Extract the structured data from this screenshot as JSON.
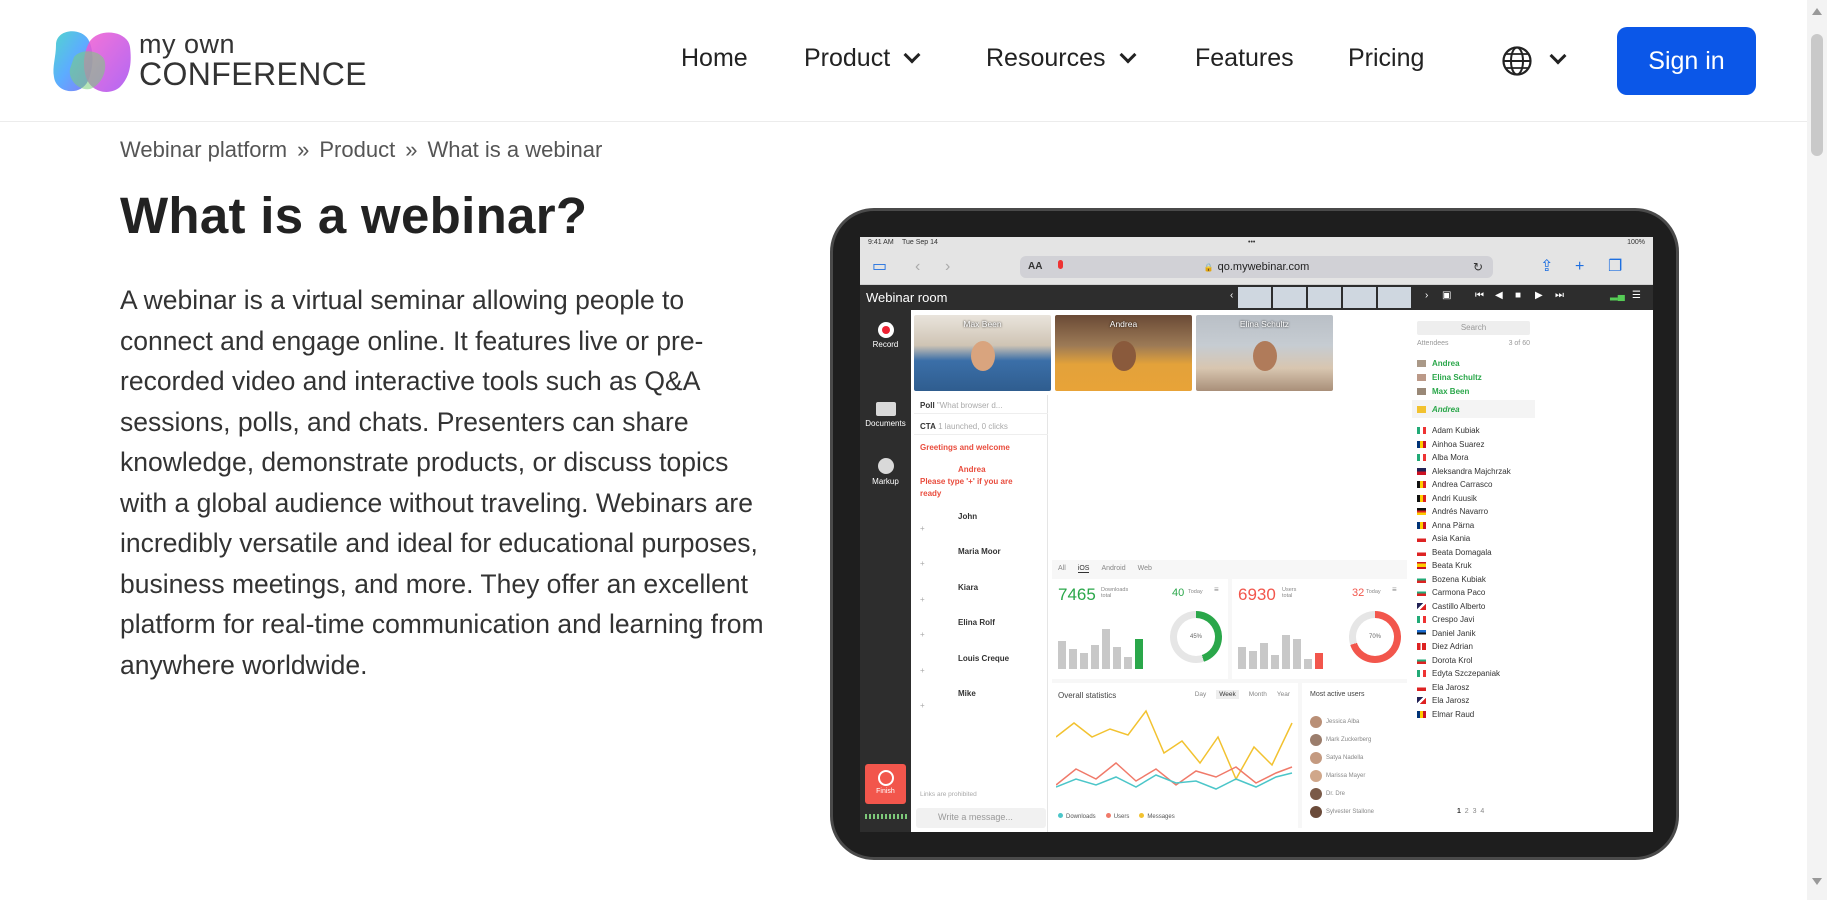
{
  "logo": {
    "line1": "my own",
    "line2": "CONFERENCE"
  },
  "nav": {
    "items": [
      {
        "label": "Home",
        "dropdown": false
      },
      {
        "label": "Product",
        "dropdown": true
      },
      {
        "label": "Resources",
        "dropdown": true
      },
      {
        "label": "Features",
        "dropdown": false
      },
      {
        "label": "Pricing",
        "dropdown": false
      }
    ],
    "language_icon": "globe-icon",
    "signin_label": "Sign in"
  },
  "colors": {
    "accent": "#0b57e8",
    "finish": "#f2564c",
    "green": "#2aa74a"
  },
  "breadcrumb": [
    "Webinar platform",
    "Product",
    "What is a webinar"
  ],
  "page": {
    "title": "What is a webinar?",
    "description": "A webinar is a virtual seminar allowing people to connect and engage online. It features live or pre-recorded video and interactive tools such as Q&A sessions, polls, and chats. Presenters can share knowledge, demonstrate products, or discuss topics with a global audience without traveling. Webinars are incredibly versatile and ideal for educational purposes, business meetings, and more. They offer an excellent platform for real-time communication and learning from anywhere worldwide."
  },
  "tablet": {
    "status_time": "9:41 AM",
    "status_date": "Tue Sep 14",
    "status_battery": "100%",
    "url": "qo.mywebinar.com",
    "aa": "AA",
    "room_title": "Webinar room",
    "sidebar": {
      "record": "Record",
      "documents": "Documents",
      "markup": "Markup",
      "finish": "Finish"
    },
    "videos": [
      "Max Been",
      "Andrea",
      "Elina Schultz"
    ],
    "chat": {
      "poll_label": "Poll",
      "poll_text": "\"What browser d...",
      "cta_label": "CTA",
      "cta_text": "1 launched, 0 clicks",
      "greeting": "Greetings and welcome",
      "host_name": "Andrea",
      "host_msg_1": "Please type '+' if you are",
      "host_msg_2": "ready",
      "messages": [
        "John",
        "Maria Moor",
        "Kiara",
        "Elina Rolf",
        "Louis Creque",
        "Mike"
      ],
      "plus": "+",
      "links_note": "Links are prohibited",
      "input_placeholder": "Write a message..."
    },
    "dashboard": {
      "tabs": [
        "All",
        "iOS",
        "Android",
        "Web"
      ],
      "downloads_total": "7465",
      "downloads_caption_1": "Downloads",
      "downloads_caption_2": "total",
      "downloads_today": "40",
      "users_total": "6930",
      "users_caption_1": "Users",
      "users_caption_2": "total",
      "users_today": "32",
      "today_label": "Today",
      "donut1": "45%",
      "donut2": "70%",
      "overall_title": "Overall statistics",
      "periods": [
        "Day",
        "Week",
        "Month",
        "Year"
      ],
      "legend": [
        "Downloads",
        "Users",
        "Messages"
      ],
      "most_active_title": "Most active users",
      "most_active": [
        "Jessica Alba",
        "Mark Zuckerberg",
        "Satya Nadella",
        "Marissa Mayer",
        "Dr. Dre",
        "Sylvester Stallone"
      ]
    },
    "attendees": {
      "search": "Search",
      "label": "Attendees",
      "count": "3 of 60",
      "presenters": [
        "Andrea",
        "Elina Schultz",
        "Max Been"
      ],
      "current": "Andrea",
      "list": [
        "Adam Kubiak",
        "Ainhoa Suarez",
        "Alba Mora",
        "Aleksandra Majchrzak",
        "Andrea Carrasco",
        "Andri Kuusik",
        "Andrés Navarro",
        "Anna Pärna",
        "Asia Kania",
        "Beata Domagala",
        "Beata Kruk",
        "Bozena Kubiak",
        "Carmona Paco",
        "Castillo Alberto",
        "Crespo Javi",
        "Daniel Janik",
        "Diez Adrian",
        "Dorota Krol",
        "Edyta Szczepaniak",
        "Ela Jarosz",
        "Ela Jarosz",
        "Elmar Raud"
      ],
      "pages": [
        "1",
        "2",
        "3",
        "4"
      ]
    }
  }
}
